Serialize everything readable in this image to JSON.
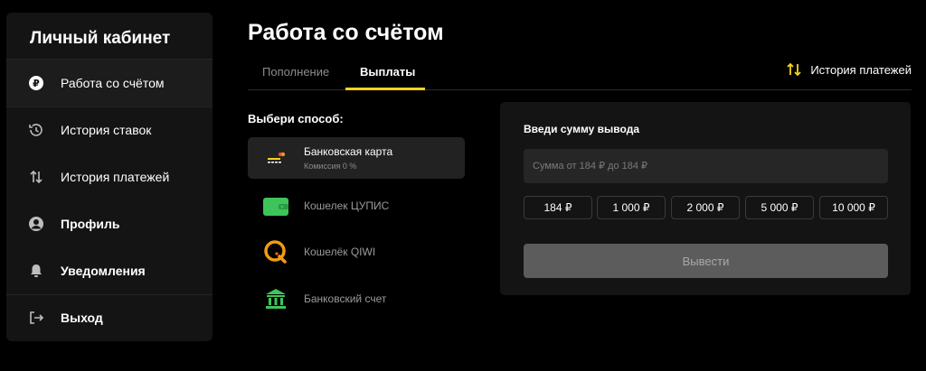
{
  "sidebar": {
    "title": "Личный кабинет",
    "items": [
      {
        "label": "Работа со счётом",
        "icon": "ruble-icon"
      },
      {
        "label": "История ставок",
        "icon": "history-icon"
      },
      {
        "label": "История платежей",
        "icon": "transfer-arrows-icon"
      },
      {
        "label": "Профиль",
        "icon": "user-icon"
      },
      {
        "label": "Уведомления",
        "icon": "bell-icon"
      },
      {
        "label": "Выход",
        "icon": "logout-icon"
      }
    ]
  },
  "main": {
    "title": "Работа со счётом",
    "tabs": [
      {
        "label": "Пополнение",
        "active": false
      },
      {
        "label": "Выплаты",
        "active": true
      }
    ],
    "history_link": "История платежей",
    "choose_label": "Выбери способ:",
    "methods": [
      {
        "name": "Банковская карта",
        "sub": "Комиссия 0 %",
        "icon": "bank-card-icon"
      },
      {
        "name": "Кошелек ЦУПИС",
        "sub": "",
        "icon": "wallet-icon"
      },
      {
        "name": "Кошелёк QIWI",
        "sub": "",
        "icon": "qiwi-icon"
      },
      {
        "name": "Банковский счет",
        "sub": "",
        "icon": "bank-building-icon"
      }
    ]
  },
  "withdraw": {
    "title": "Введи сумму вывода",
    "placeholder": "Сумма от 184 ₽ до 184 ₽",
    "presets": [
      "184 ₽",
      "1 000 ₽",
      "2 000 ₽",
      "5 000 ₽",
      "10 000 ₽"
    ],
    "button": "Вывести"
  },
  "colors": {
    "accent": "#f5d224",
    "green": "#3ec45a",
    "panel": "#141414"
  }
}
